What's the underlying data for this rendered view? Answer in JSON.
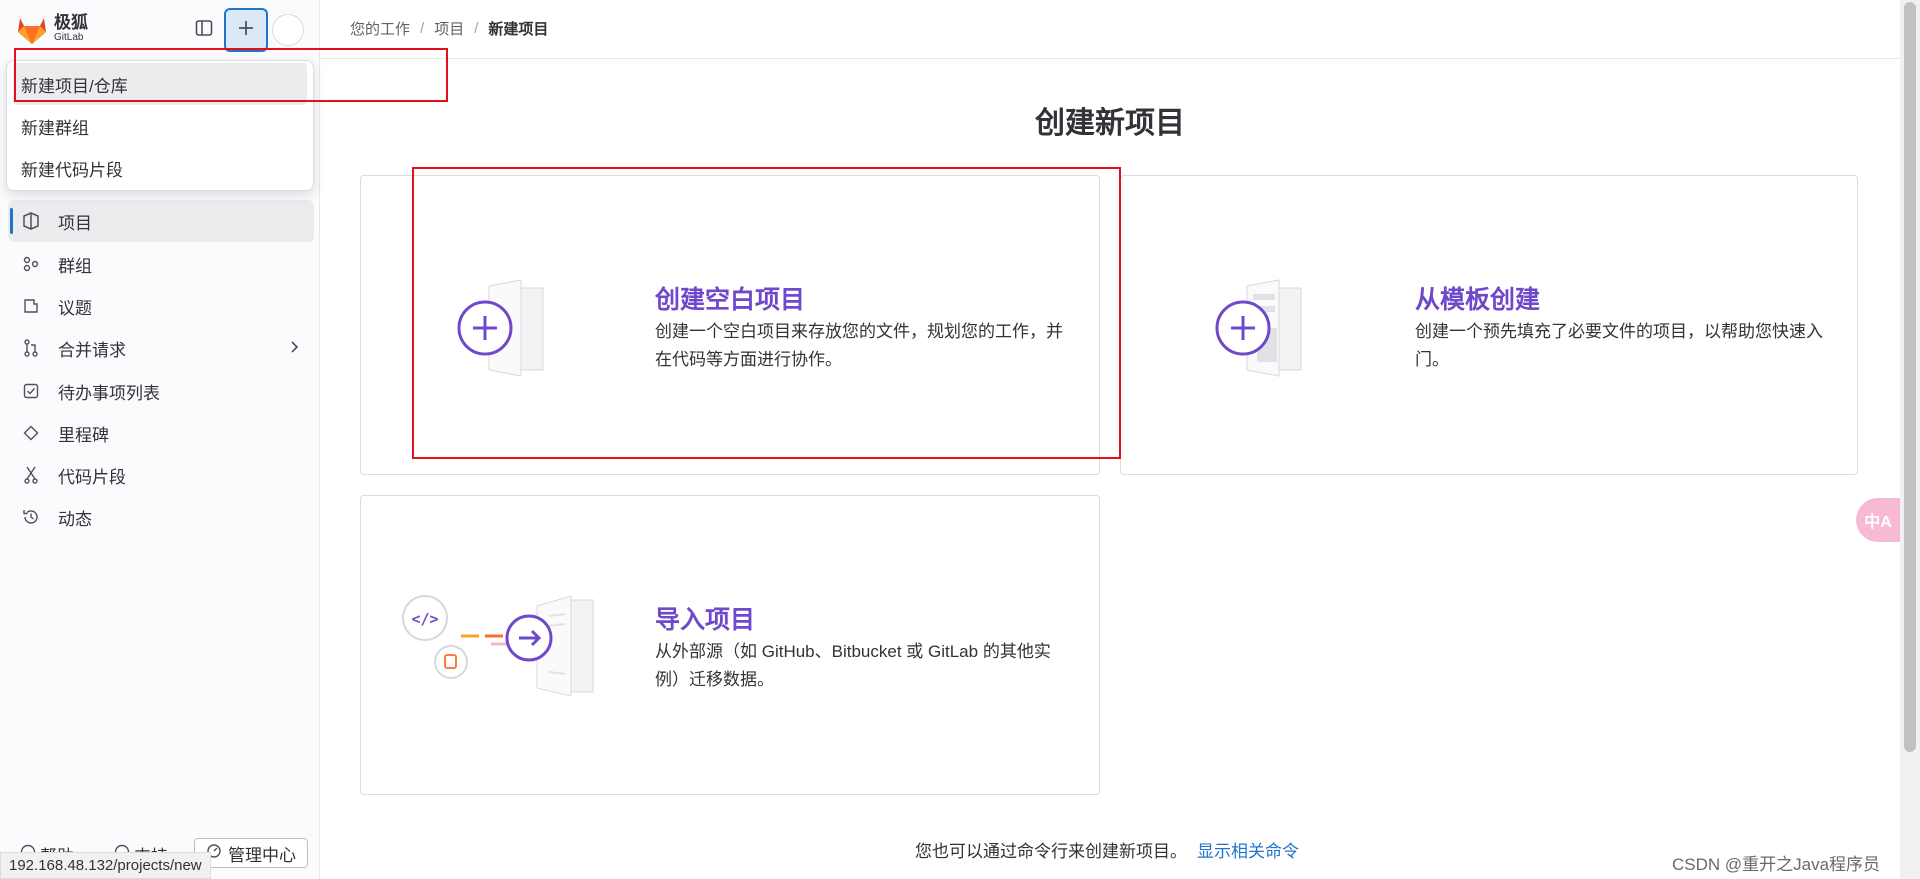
{
  "app": {
    "logo_title": "极狐",
    "logo_subtitle": "GitLab"
  },
  "dropdown": {
    "items": [
      {
        "label": "新建项目/仓库",
        "active": true
      },
      {
        "label": "新建群组"
      },
      {
        "label": "新建代码片段"
      }
    ]
  },
  "sidebar": {
    "items": [
      {
        "label": "项目",
        "icon": "project-icon",
        "active": true
      },
      {
        "label": "群组",
        "icon": "group-icon"
      },
      {
        "label": "议题",
        "icon": "issues-icon"
      },
      {
        "label": "合并请求",
        "icon": "merge-request-icon"
      },
      {
        "label": "待办事项列表",
        "icon": "todo-icon"
      },
      {
        "label": "里程碑",
        "icon": "milestone-icon"
      },
      {
        "label": "代码片段",
        "icon": "snippet-icon"
      },
      {
        "label": "动态",
        "icon": "activity-icon"
      }
    ],
    "help_label": "帮助",
    "support_label": "支持",
    "admin_label": "管理中心"
  },
  "breadcrumb": [
    "您的工作",
    "项目",
    "新建项目"
  ],
  "page_title": "创建新项目",
  "cards": [
    {
      "title": "创建空白项目",
      "description": "创建一个空白项目来存放您的文件，规划您的工作，并在代码等方面进行协作。"
    },
    {
      "title": "从模板创建",
      "description": "创建一个预先填充了必要文件的项目，以帮助您快速入门。"
    },
    {
      "title": "导入项目",
      "description": "从外部源（如 GitHub、Bitbucket 或 GitLab 的其他实例）迁移数据。"
    }
  ],
  "footer": {
    "note": "您也可以通过命令行来创建新项目。",
    "link": "显示相关命令"
  },
  "status_url": "192.168.48.132/projects/new",
  "watermark": "CSDN @重开之Java程序员",
  "float_button": "中A",
  "colors": {
    "accent_purple": "#6e49cb",
    "link_blue": "#1f75cb",
    "highlight_red": "#e0101f"
  }
}
